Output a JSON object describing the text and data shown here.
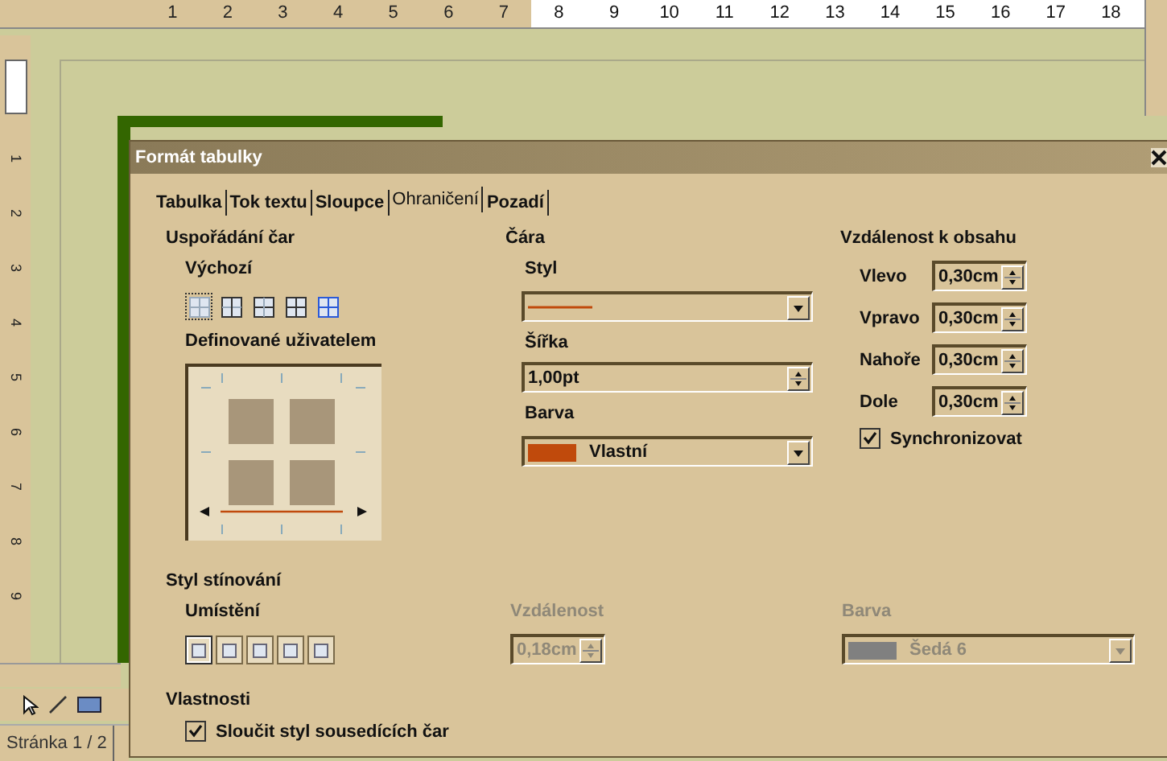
{
  "ruler": {
    "numbers": [
      "1",
      "2",
      "3",
      "4",
      "5",
      "6",
      "7",
      "8",
      "9",
      "10",
      "11",
      "12",
      "13",
      "14",
      "15",
      "16",
      "17",
      "18"
    ]
  },
  "vertical_ruler": {
    "numbers": [
      "1",
      "2",
      "3",
      "4",
      "5",
      "6",
      "7",
      "8",
      "9"
    ]
  },
  "status_bar": {
    "page": "Stránka 1 / 2"
  },
  "dialog": {
    "title": "Formát tabulky",
    "tabs": [
      {
        "label": "Tabulka",
        "selected": false
      },
      {
        "label": "Tok textu",
        "selected": false
      },
      {
        "label": "Sloupce",
        "selected": false
      },
      {
        "label": "Ohraničení",
        "selected": true
      },
      {
        "label": "Pozadí",
        "selected": false
      }
    ],
    "line_arrangement": {
      "title": "Uspořádání čar",
      "default_label": "Výchozí",
      "presets": [
        {
          "selected": true
        },
        {
          "selected": false
        },
        {
          "selected": false
        },
        {
          "selected": false
        },
        {
          "selected": false
        }
      ],
      "user_defined_label": "Definované uživatelem"
    },
    "line": {
      "title": "Čára",
      "style_label": "Styl",
      "width_label": "Šířka",
      "width_value": "1,00pt",
      "color_label": "Barva",
      "color_value": "Vlastní",
      "color": "#c04a0c"
    },
    "spacing": {
      "title": "Vzdálenost k obsahu",
      "fields": [
        {
          "label": "Vlevo",
          "value": "0,30cm"
        },
        {
          "label": "Vpravo",
          "value": "0,30cm"
        },
        {
          "label": "Nahoře",
          "value": "0,30cm"
        },
        {
          "label": "Dole",
          "value": "0,30cm"
        }
      ],
      "sync": {
        "label": "Synchronizovat",
        "checked": true
      }
    },
    "shadow": {
      "title": "Styl stínování",
      "position_label": "Umístění",
      "positions": [
        {
          "selected": true
        },
        {
          "selected": false
        },
        {
          "selected": false
        },
        {
          "selected": false
        },
        {
          "selected": false
        }
      ],
      "distance": {
        "label": "Vzdálenost",
        "value": "0,18cm",
        "disabled": true
      },
      "color": {
        "label": "Barva",
        "value": "Šedá 6",
        "color": "#808080",
        "disabled": true
      }
    },
    "properties": {
      "title": "Vlastnosti",
      "merge": {
        "label": "Sloučit styl sousedících čar",
        "checked": true
      }
    }
  }
}
